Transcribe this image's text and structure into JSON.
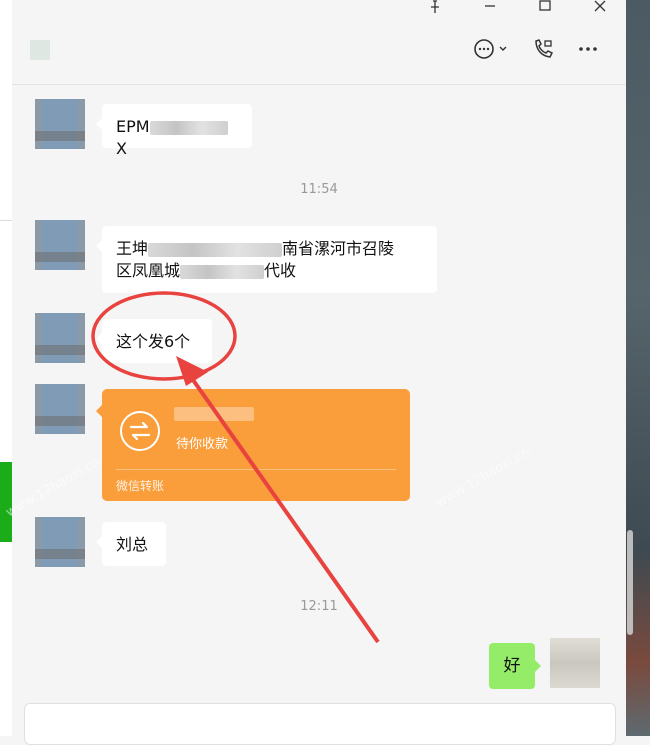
{
  "window": {
    "pin_icon": "pin-icon",
    "minimize_icon": "minimize-icon",
    "maximize_icon": "maximize-icon",
    "close_icon": "close-icon"
  },
  "header": {
    "chat_icon": "chat-bubble-icon",
    "call_icon": "video-call-icon",
    "more_icon": "more-icon"
  },
  "messages": {
    "m1_prefix": "EPM",
    "m1_suffix": "X",
    "time1": "11:54",
    "m2_line1_prefix": "王坤",
    "m2_line1_suffix": "南省漯河市召陵",
    "m2_line2_prefix": "区凤凰城",
    "m2_line2_suffix": "代收",
    "m3": "这个发6个",
    "transfer_status": "待你收款",
    "transfer_footer": "微信转账",
    "m5": "刘总",
    "time2": "12:11",
    "my_msg": "好"
  },
  "watermark": "www.12haoxi.cn",
  "colors": {
    "accent_green": "#95ec69",
    "transfer_orange": "#fa9d3b",
    "annotation_red": "#e8433f",
    "sidebar_green": "#1aad19"
  }
}
